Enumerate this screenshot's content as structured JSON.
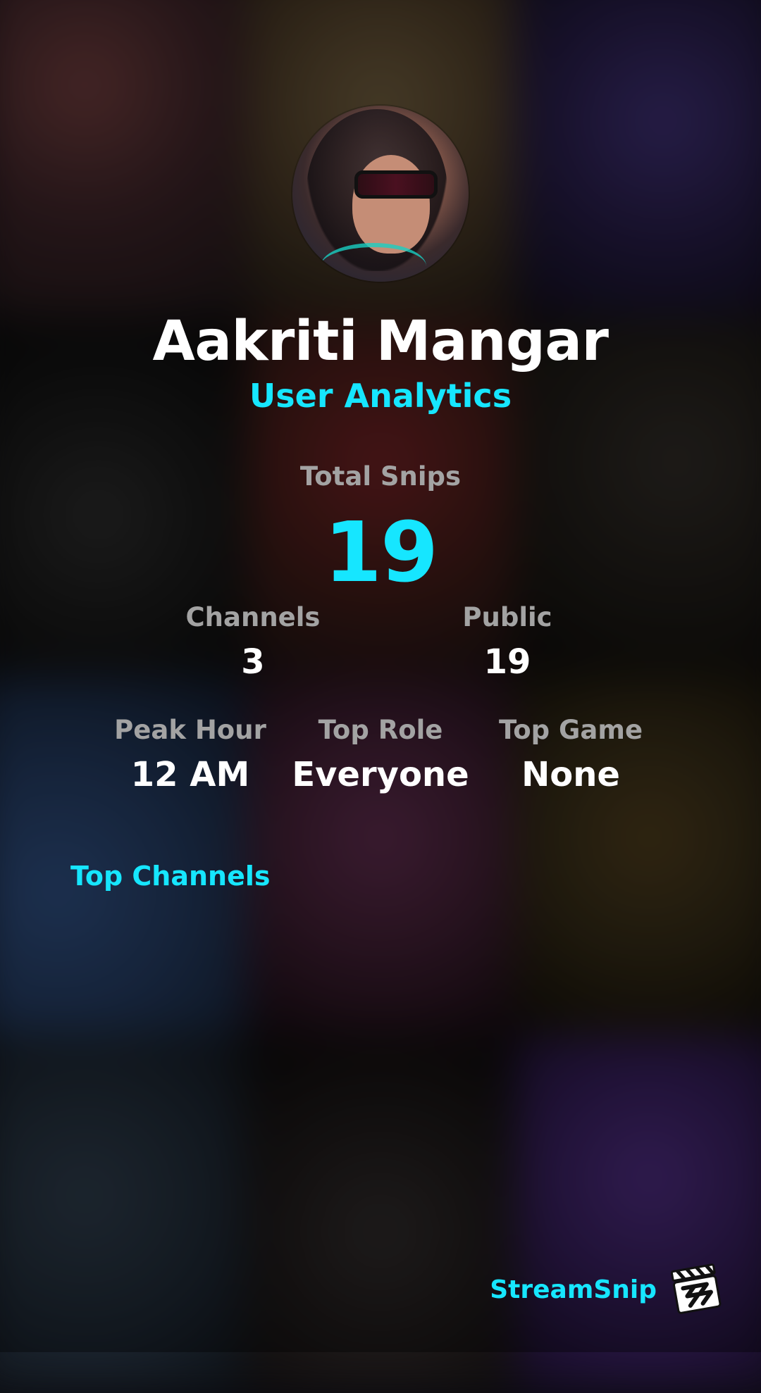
{
  "profile": {
    "name": "Aakriti Mangar",
    "subtitle": "User Analytics"
  },
  "stats": {
    "total_label": "Total Snips",
    "total_value": "19",
    "channels_label": "Channels",
    "channels_value": "3",
    "public_label": "Public",
    "public_value": "19",
    "peak_hour_label": "Peak Hour",
    "peak_hour_value": "12 AM",
    "top_role_label": "Top Role",
    "top_role_value": "Everyone",
    "top_game_label": "Top Game",
    "top_game_value": "None"
  },
  "sections": {
    "top_channels": "Top Channels"
  },
  "brand": {
    "name": "StreamSnip",
    "logo_icon": "clapperboard-icon"
  },
  "colors": {
    "accent": "#16e6ff",
    "label": "#a3a3a3",
    "text": "#ffffff"
  }
}
